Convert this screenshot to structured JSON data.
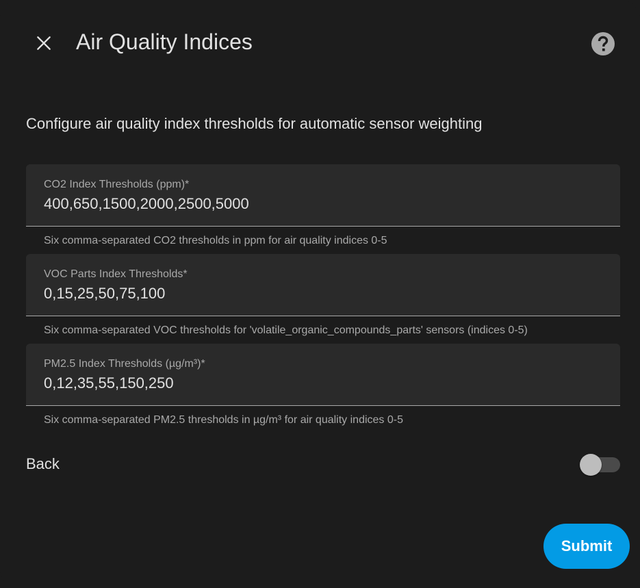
{
  "dialog": {
    "title": "Air Quality Indices",
    "close_icon": "close-icon",
    "help_icon": "help-circle-icon",
    "description": "Configure air quality index thresholds for automatic sensor weighting"
  },
  "fields": [
    {
      "label": "CO2 Index Thresholds (ppm)*",
      "value": "400,650,1500,2000,2500,5000",
      "helper": "Six comma-separated CO2 thresholds in ppm for air quality indices 0-5"
    },
    {
      "label": "VOC Parts Index Thresholds*",
      "value": "0,15,25,50,75,100",
      "helper": "Six comma-separated VOC thresholds for 'volatile_organic_compounds_parts' sensors (indices 0-5)"
    },
    {
      "label": "PM2.5 Index Thresholds (µg/m³)*",
      "value": "0,12,35,55,150,250",
      "helper": "Six comma-separated PM2.5 thresholds in µg/m³ for air quality indices 0-5"
    }
  ],
  "back": {
    "label": "Back",
    "enabled": false
  },
  "actions": {
    "submit_label": "Submit"
  },
  "colors": {
    "background": "#1c1c1c",
    "field_background": "#2a2a2a",
    "primary": "#039be5",
    "text": "#e1e1e1",
    "secondary_text": "#a9a9a9"
  }
}
